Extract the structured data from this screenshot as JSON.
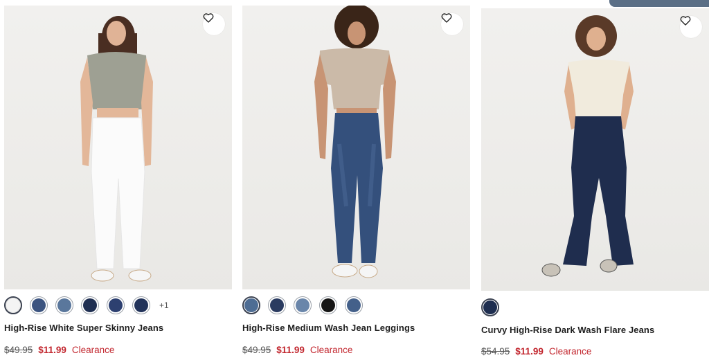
{
  "products": [
    {
      "name": "High-Rise White Super Skinny Jeans",
      "original_price": "$49.95",
      "sale_price": "$11.99",
      "badge": "Clearance",
      "swatches": [
        {
          "color": "#f4f4f4",
          "selected": true
        },
        {
          "color": "#3c5480",
          "selected": false
        },
        {
          "color": "#5a779c",
          "selected": false
        },
        {
          "color": "#1f2f52",
          "selected": false
        },
        {
          "color": "#2d4070",
          "selected": false
        },
        {
          "color": "#22335a",
          "selected": false
        }
      ],
      "more_colors": "+1"
    },
    {
      "name": "High-Rise Medium Wash Jean Leggings",
      "original_price": "$49.95",
      "sale_price": "$11.99",
      "badge": "Clearance",
      "swatches": [
        {
          "color": "#4e6d94",
          "selected": true
        },
        {
          "color": "#2a3b60",
          "selected": false
        },
        {
          "color": "#6a86aa",
          "selected": false
        },
        {
          "color": "#151515",
          "selected": false
        },
        {
          "color": "#44608a",
          "selected": false
        }
      ],
      "more_colors": ""
    },
    {
      "name": "Curvy High-Rise Dark Wash Flare Jeans",
      "original_price": "$54.95",
      "sale_price": "$11.99",
      "badge": "Clearance",
      "swatches": [
        {
          "color": "#1e2e50",
          "selected": true
        }
      ],
      "more_colors": ""
    }
  ],
  "colors": {
    "sale": "#c2262e",
    "photo_bg": "#eeedeb"
  },
  "icons": {
    "favorite": "heart-outline-icon"
  }
}
